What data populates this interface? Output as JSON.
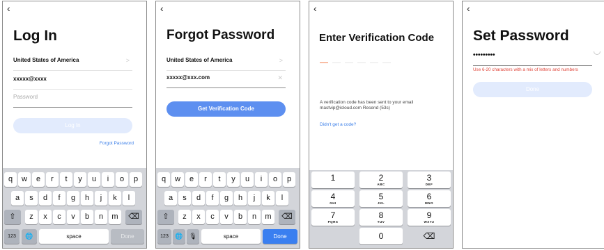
{
  "screens": {
    "login": {
      "back_icon": "‹",
      "title": "Log In",
      "country": "United States of America",
      "account_value": "xxxxx@xxxx",
      "password_placeholder": "Password",
      "login_button": "Log In",
      "forgot_link": "Forgot Password"
    },
    "forgot": {
      "back_icon": "‹",
      "title": "Forgot Password",
      "country": "United States of America",
      "email_value": "xxxxx@xxx.com",
      "get_code_button": "Get Verification Code"
    },
    "verify": {
      "back_icon": "‹",
      "title": "Enter Verification Code",
      "message_line1": "A verification code has been sent to your email",
      "message_line2": "mastvip@icloud.com  Resend (53s)",
      "no_code_link": "Didn't get a code?"
    },
    "setpw": {
      "back_icon": "‹",
      "title": "Set Password",
      "password_value": "•••••••••",
      "error": "Use 6-20 characters with a mix of letters and numbers",
      "done_button": "Done"
    }
  },
  "keyboard": {
    "row1": [
      "q",
      "w",
      "e",
      "r",
      "t",
      "y",
      "u",
      "i",
      "o",
      "p"
    ],
    "row2": [
      "a",
      "s",
      "d",
      "f",
      "g",
      "h",
      "j",
      "k",
      "l"
    ],
    "row3": [
      "z",
      "x",
      "c",
      "v",
      "b",
      "n",
      "m"
    ],
    "shift": "⇧",
    "backspace": "⌫",
    "num_key": "123",
    "globe": "🌐",
    "mic": "🎙",
    "space": "space",
    "done": "Done"
  },
  "numpad": {
    "keys": [
      {
        "d": "1",
        "l": ""
      },
      {
        "d": "2",
        "l": "ABC"
      },
      {
        "d": "3",
        "l": "DEF"
      },
      {
        "d": "4",
        "l": "GHI"
      },
      {
        "d": "5",
        "l": "JKL"
      },
      {
        "d": "6",
        "l": "MNO"
      },
      {
        "d": "7",
        "l": "PQRS"
      },
      {
        "d": "8",
        "l": "TUV"
      },
      {
        "d": "9",
        "l": "WXYZ"
      },
      {
        "d": "",
        "l": ""
      },
      {
        "d": "0",
        "l": ""
      },
      {
        "d": "⌫",
        "l": ""
      }
    ]
  },
  "colors": {
    "accent_blue": "#5d8ff0",
    "light_blue": "#e2ebfd",
    "error_red": "#e0453a",
    "code_active": "#f27b48"
  }
}
